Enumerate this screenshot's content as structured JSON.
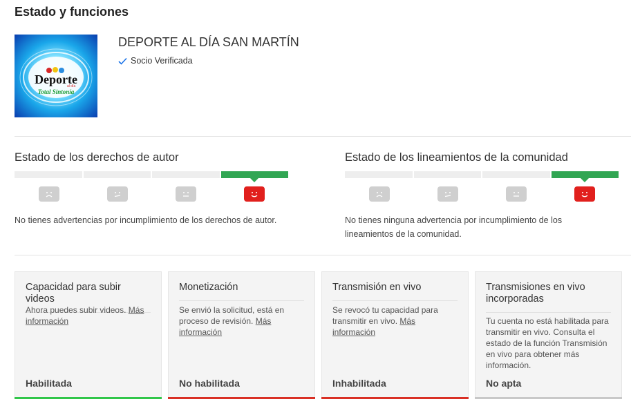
{
  "page": {
    "title": "Estado y funciones"
  },
  "channel": {
    "name": "DEPORTE AL DÍA SAN MARTÍN",
    "verified_label": "Socio Verificada",
    "logo_text": {
      "main": "Deporte",
      "small": "al día",
      "tagline": "Total Sintonía"
    }
  },
  "colors": {
    "green": "#31a653",
    "red": "#e1201d",
    "grey": "#cfcfcf",
    "accent_blue": "#1a73e8"
  },
  "copyright": {
    "title": "Estado de los derechos de autor",
    "description": "No tienes advertencias por incumplimiento de los derechos de autor.",
    "active_level": 4
  },
  "community": {
    "title": "Estado de los lineamientos de la comunidad",
    "description_line1": "No tienes ninguna advertencia por incumplimiento de los",
    "description_line2": "lineamientos de la comunidad.",
    "active_level": 4
  },
  "cards": [
    {
      "title": "Capacidad para subir videos",
      "body": "Ahora puedes subir videos.",
      "link": "Más información",
      "status": "Habilitada",
      "status_color": "#31c64a"
    },
    {
      "title": "Monetización",
      "body": "Se envió la solicitud, está en proceso de revisión.",
      "link": "Más información",
      "status": "No habilitada",
      "status_color": "#d93025"
    },
    {
      "title": "Transmisión en vivo",
      "body": "Se revocó tu capacidad para transmitir en vivo.",
      "link": "Más información",
      "status": "Inhabilitada",
      "status_color": "#d93025"
    },
    {
      "title": "Transmisiones en vivo incorporadas",
      "body": "Tu cuenta no está habilitada para transmitir en vivo. Consulta el estado de la función Transmisión en vivo para obtener más información.",
      "link": "",
      "status": "No apta",
      "status_color": "#9e9e9e"
    }
  ]
}
